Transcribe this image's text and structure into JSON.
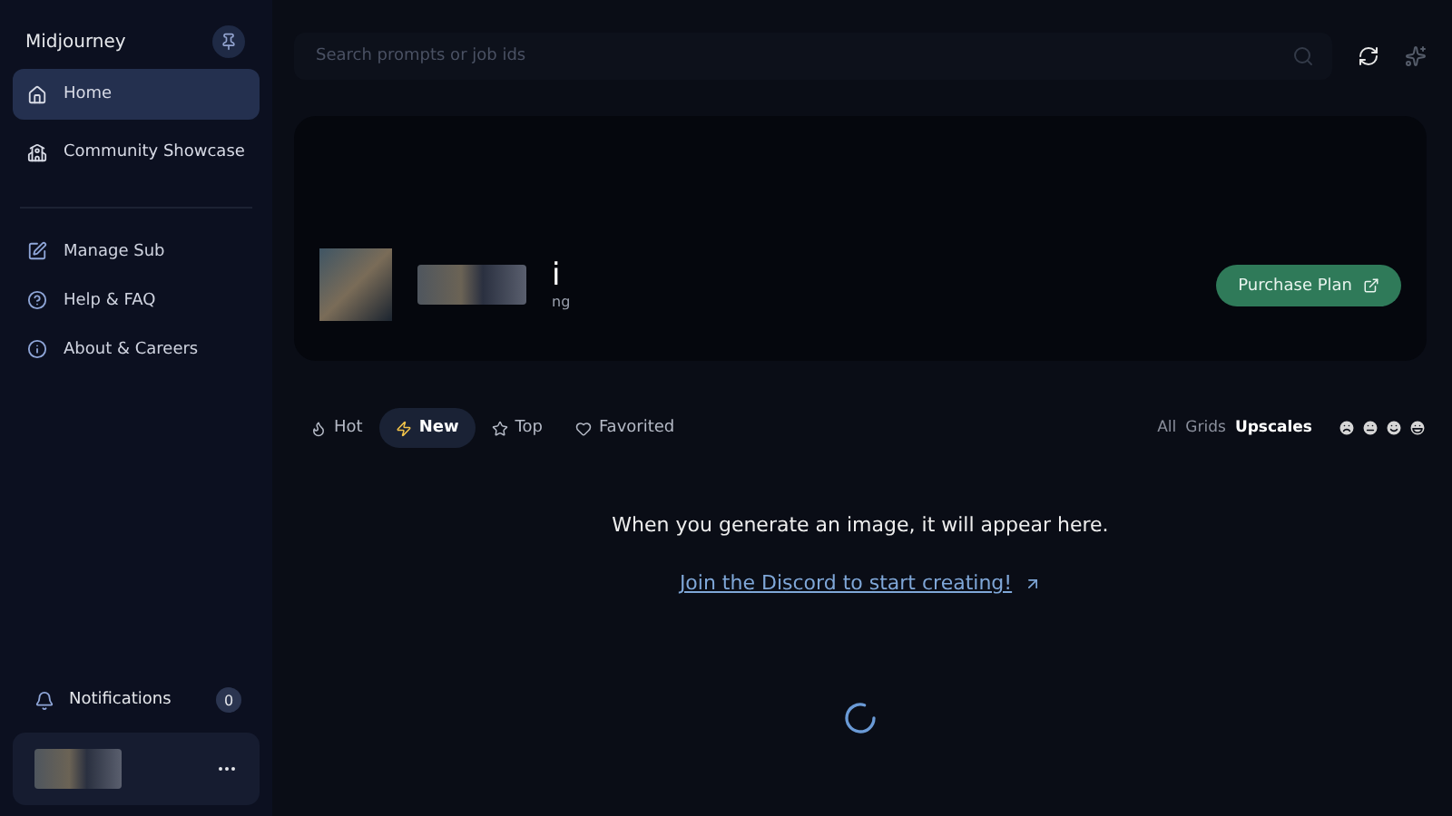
{
  "sidebar": {
    "brand": "Midjourney",
    "nav": [
      {
        "label": "Home",
        "kind": "home",
        "selected": true
      },
      {
        "label": "Community Showcase",
        "kind": "community",
        "selected": false
      }
    ],
    "links": [
      {
        "label": "Manage Sub",
        "kind": "edit"
      },
      {
        "label": "Help & FAQ",
        "kind": "help"
      },
      {
        "label": "About & Careers",
        "kind": "info"
      }
    ],
    "notifications": {
      "label": "Notifications",
      "count": "0"
    }
  },
  "search": {
    "placeholder": "Search prompts or job ids"
  },
  "profile": {
    "name": "i",
    "subtitle": "ng",
    "purchase_button": "Purchase Plan"
  },
  "feed_tabs": [
    {
      "label": "Hot",
      "kind": "hot",
      "selected": false
    },
    {
      "label": "New",
      "kind": "new",
      "selected": true
    },
    {
      "label": "Top",
      "kind": "top",
      "selected": false
    },
    {
      "label": "Favorited",
      "kind": "favorited",
      "selected": false
    }
  ],
  "filters": [
    {
      "label": "All",
      "selected": false
    },
    {
      "label": "Grids",
      "selected": false
    },
    {
      "label": "Upscales",
      "selected": true
    }
  ],
  "empty_state": {
    "message": "When you generate an image, it will appear here.",
    "link": "Join the Discord to start creating!"
  }
}
